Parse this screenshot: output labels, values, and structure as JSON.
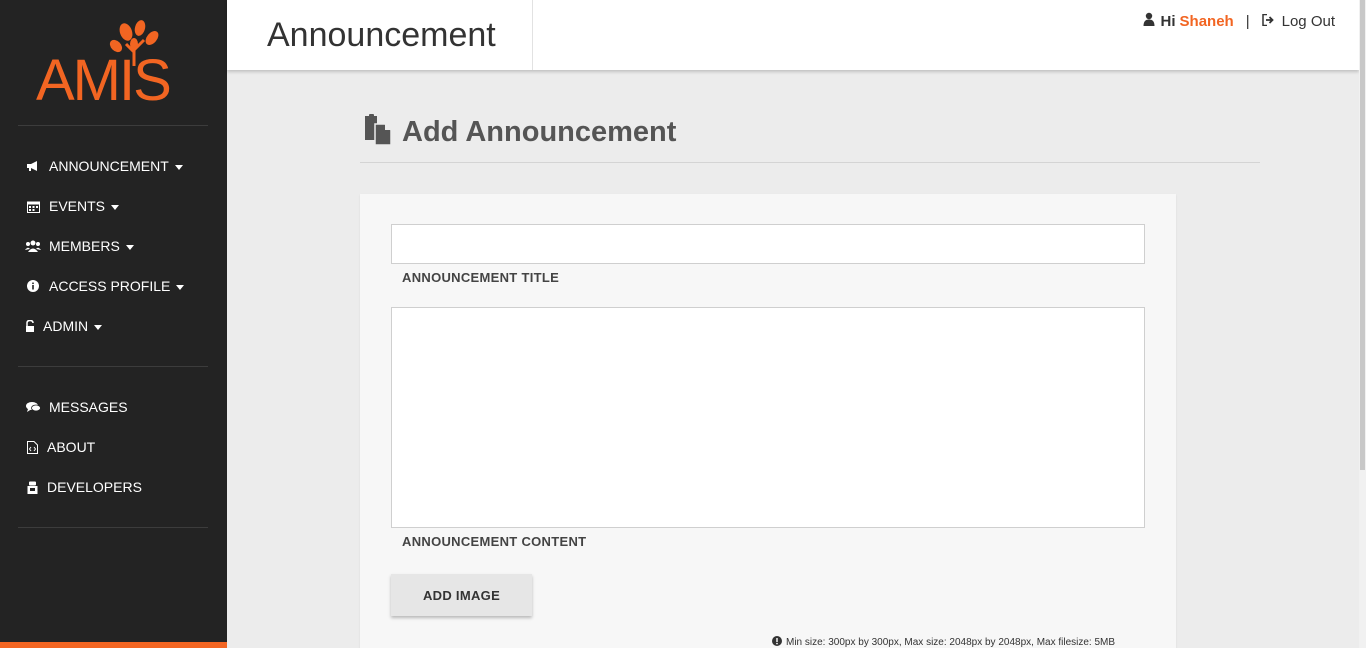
{
  "brand": {
    "logo_text": "AMIS",
    "accent_color": "#f26522",
    "sidebar_bg": "#232323"
  },
  "sidebar": {
    "menu_primary": [
      {
        "label": "ANNOUNCEMENT",
        "icon": "bullhorn-icon",
        "has_caret": true
      },
      {
        "label": "EVENTS",
        "icon": "calendar-icon",
        "has_caret": true
      },
      {
        "label": "MEMBERS",
        "icon": "users-icon",
        "has_caret": true
      },
      {
        "label": "ACCESS PROFILE",
        "icon": "info-circle-icon",
        "has_caret": true
      },
      {
        "label": "ADMIN",
        "icon": "unlock-icon",
        "has_caret": true
      }
    ],
    "menu_secondary": [
      {
        "label": "MESSAGES",
        "icon": "comments-icon"
      },
      {
        "label": "ABOUT",
        "icon": "file-code-icon"
      },
      {
        "label": "DEVELOPERS",
        "icon": "developer-icon"
      }
    ]
  },
  "header": {
    "title": "Announcement",
    "greeting": "Hi",
    "username": "Shaneh",
    "separator": "|",
    "logout_label": "Log Out"
  },
  "main": {
    "heading": "Add Announcement",
    "form": {
      "title_value": "",
      "title_label": "ANNOUNCEMENT TITLE",
      "content_value": "",
      "content_label": "ANNOUNCEMENT CONTENT",
      "add_image_label": "ADD IMAGE",
      "hint": "Min size: 300px by 300px, Max size: 2048px by 2048px, Max filesize: 5MB"
    }
  }
}
